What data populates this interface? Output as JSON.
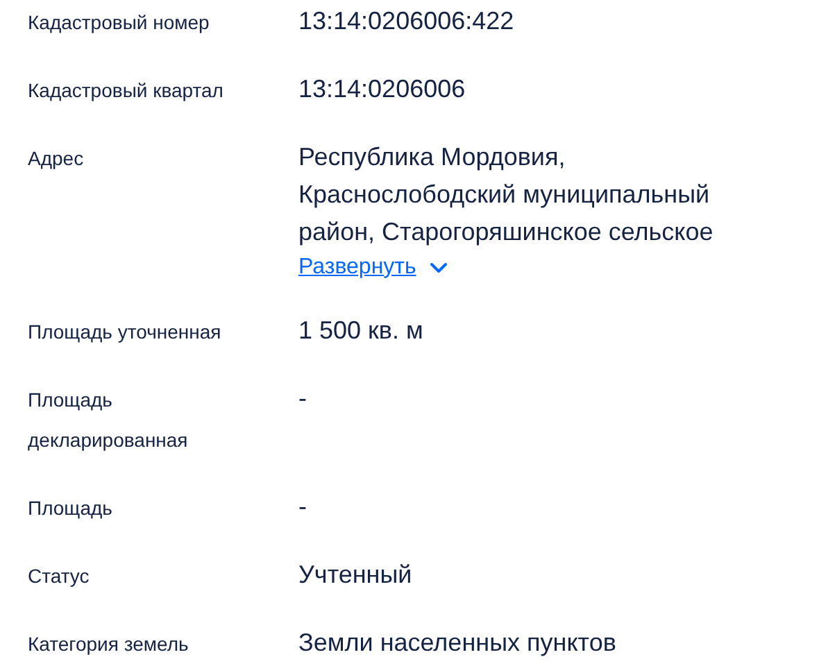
{
  "fields": [
    {
      "label": "Кадастровый номер",
      "value": "13:14:0206006:422"
    },
    {
      "label": "Кадастровый квартал",
      "value": "13:14:0206006"
    },
    {
      "label": "Адрес",
      "value": "Республика Мордовия, Краснослободский муниципальный район, Старогоряшинское сельское",
      "expand_link": "Развернуть"
    },
    {
      "label": "Площадь уточненная",
      "value": "1 500 кв. м"
    },
    {
      "label": "Площадь декларированная",
      "value": "-"
    },
    {
      "label": "Площадь",
      "value": "-"
    },
    {
      "label": "Статус",
      "value": "Учтенный"
    },
    {
      "label": "Категория земель",
      "value": "Земли населенных пунктов"
    }
  ]
}
